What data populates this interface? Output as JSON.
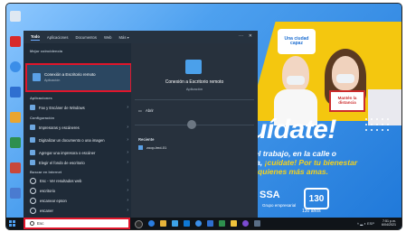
{
  "start_menu": {
    "tabs": [
      "Todo",
      "Aplicaciones",
      "Documentos",
      "Web",
      "Más ▾"
    ],
    "more_icon": "ellipsis-icon",
    "close_icon": "close-icon",
    "best_match_section": "Mejor coincidencia",
    "best_match": {
      "title": "Conexión a Escritorio remoto",
      "subtitle": "Aplicación"
    },
    "apps_section": "Aplicaciones",
    "apps": [
      {
        "label": "Fax y Escáner de Windows"
      }
    ],
    "settings_section": "Configuración",
    "settings": [
      {
        "label": "Impresoras y escáneres"
      },
      {
        "label": "Digitalizar un documento o una imagen"
      },
      {
        "label": "Agregar una impresora o escáner"
      },
      {
        "label": "Elegir el fondo de escritorio"
      }
    ],
    "web_section": "Buscar en Internet",
    "web": [
      {
        "label": "Esc - Ver resultados web"
      },
      {
        "label": "escritorio"
      },
      {
        "label": "escanear epson"
      },
      {
        "label": "escaner"
      },
      {
        "label": "escanear"
      }
    ],
    "detail": {
      "title": "Conexión a Escritorio remoto",
      "subtitle": "Aplicación",
      "open_label": "Abrir",
      "recent_label": "Reciente",
      "recent_items": [
        "zoop-lmd-01"
      ]
    }
  },
  "wallpaper": {
    "bubble": "Una ciudad capaz",
    "sign": "Mantén la distancia",
    "headline": "uídate!",
    "line1": "en el trabajo, en la calle o",
    "line2a": "casa, ",
    "line2b": "¡cuídate! Por tu bienestar",
    "line3": "por quienes más amas.",
    "logo1": "SSA",
    "logo1_sub": "Grupo empresarial",
    "logo2": "130",
    "logo2_sub": "130 años"
  },
  "taskbar": {
    "search_value": "Esc",
    "clock_time": "7:51 p.m.",
    "clock_date": "6/04/2021",
    "tray_text": "ESP"
  },
  "colors": {
    "highlight": "#e0162b",
    "menu_bg": "#1f2b38",
    "accent": "#4fa0f0"
  }
}
